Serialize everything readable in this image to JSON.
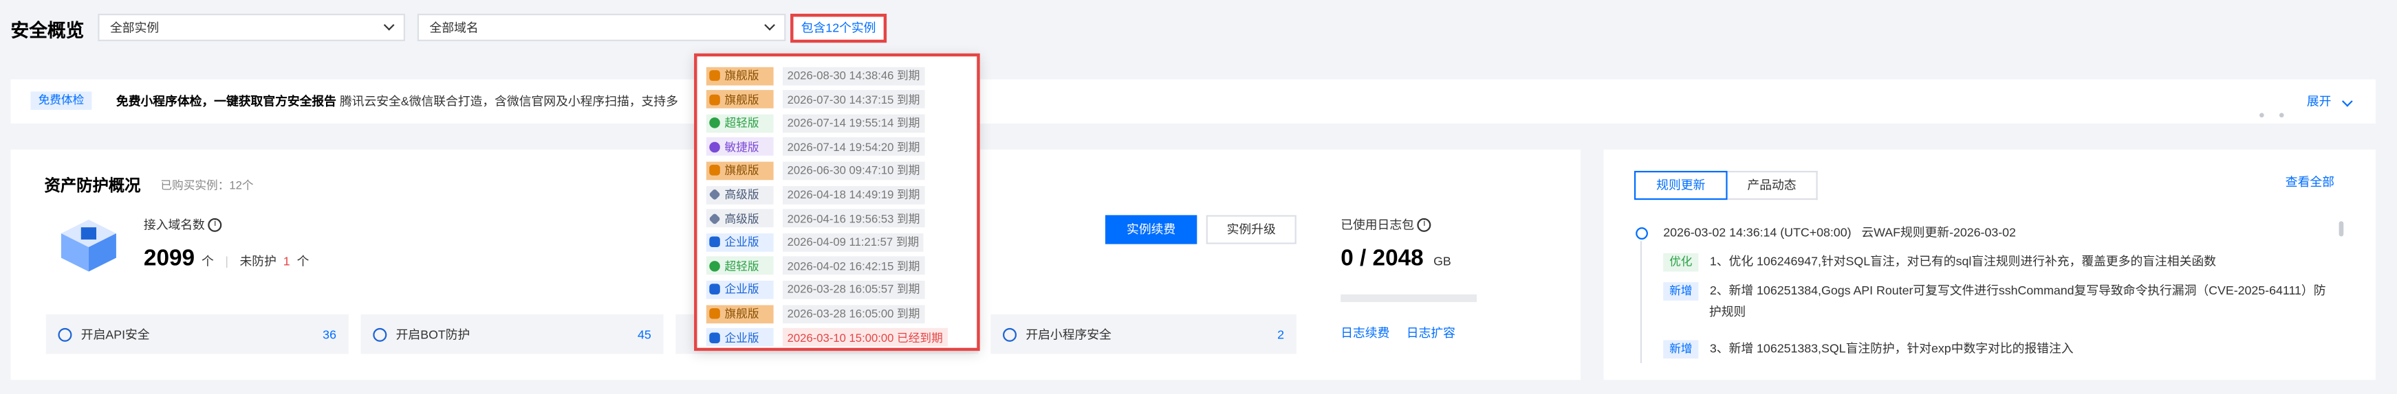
{
  "header": {
    "title": "安全概览",
    "instance_select": "全部实例",
    "domain_select": "全部域名",
    "contains_label": "包含12个实例"
  },
  "banner": {
    "tag": "免费体检",
    "headline": "免费小程序体检，一键获取官方安全报告",
    "text": "腾讯云安全&微信联合打造，含微信官网及小程序扫描，支持多",
    "expand": "展开"
  },
  "asset": {
    "title": "资产防护概况",
    "purchased": "已购买实例：12个",
    "domain_label": "接入域名数",
    "domain_count": "2099",
    "unit_ge": "个",
    "unprotected_label": "未防护",
    "unprotected_count": "1",
    "unprotected_unit": "个",
    "renew_button": "实例续费",
    "upgrade_button": "实例升级",
    "log_label": "已使用日志包",
    "log_used": "0 / 2048",
    "log_unit": "GB",
    "log_progress": 0,
    "log_renew": "日志续费",
    "log_expand": "日志扩容",
    "features": [
      {
        "label": "开启API安全",
        "count": "36"
      },
      {
        "label": "开启BOT防护",
        "count": "45"
      },
      {
        "label": "开启小程序安全",
        "count": "2"
      }
    ]
  },
  "popup": {
    "rows": [
      {
        "edition": "旗舰版",
        "style": "orange",
        "expire": "2026-08-30 14:38:46 到期",
        "expired": false
      },
      {
        "edition": "旗舰版",
        "style": "orange",
        "expire": "2026-07-30 14:37:15 到期",
        "expired": false
      },
      {
        "edition": "超轻版",
        "style": "green",
        "expire": "2026-07-14 19:55:14 到期",
        "expired": false
      },
      {
        "edition": "敏捷版",
        "style": "purple",
        "expire": "2026-07-14 19:54:20 到期",
        "expired": false
      },
      {
        "edition": "旗舰版",
        "style": "orange",
        "expire": "2026-06-30 09:47:10 到期",
        "expired": false
      },
      {
        "edition": "高级版",
        "style": "gray",
        "expire": "2026-04-18 14:49:19 到期",
        "expired": false
      },
      {
        "edition": "高级版",
        "style": "gray",
        "expire": "2026-04-16 19:56:53 到期",
        "expired": false
      },
      {
        "edition": "企业版",
        "style": "blue",
        "expire": "2026-04-09 11:21:57 到期",
        "expired": false
      },
      {
        "edition": "超轻版",
        "style": "green",
        "expire": "2026-04-02 16:42:15 到期",
        "expired": false
      },
      {
        "edition": "企业版",
        "style": "blue",
        "expire": "2026-03-28 16:05:57 到期",
        "expired": false
      },
      {
        "edition": "旗舰版",
        "style": "orange",
        "expire": "2026-03-28 16:05:00 到期",
        "expired": false
      },
      {
        "edition": "企业版",
        "style": "blue",
        "expire": "2026-03-10 15:00:00 已经到期",
        "expired": true
      }
    ]
  },
  "news": {
    "tab_rules": "规则更新",
    "tab_product": "产品动态",
    "view_all": "查看全部",
    "entry_title": "2026-03-02 14:36:14 (UTC+08:00)   云WAF规则更新-2026-03-02",
    "items": [
      {
        "tag": "优化",
        "tag_style": "green",
        "text": "1、优化 106246947,针对SQL盲注，对已有的sql盲注规则进行补充，覆盖更多的盲注相关函数"
      },
      {
        "tag": "新增",
        "tag_style": "blue",
        "text": "2、新增 106251384,Gogs API Router可复写文件进行sshCommand复写导致命令执行漏洞（CVE-2025-64111）防",
        "text2": "护规则"
      },
      {
        "tag": "新增",
        "tag_style": "blue",
        "text": "3、新增 106251383,SQL盲注防护，针对exp中数字对比的报错注入"
      }
    ]
  },
  "colors": {
    "accent": "#006eff",
    "danger": "#e54545"
  }
}
